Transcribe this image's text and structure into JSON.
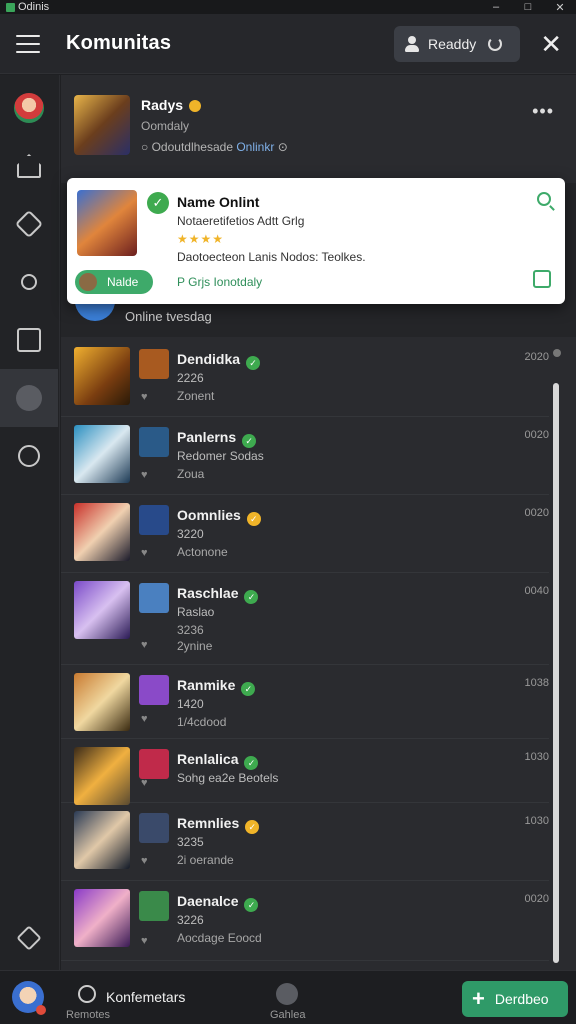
{
  "window": {
    "title": "Odinis",
    "controls": [
      "–",
      "□",
      "✕"
    ]
  },
  "header": {
    "title": "Komunitas",
    "ready_label": "Readdy",
    "close_label": "✕"
  },
  "sidebar": {
    "items": [
      {
        "icon": "avatar-icon"
      },
      {
        "icon": "home-icon"
      },
      {
        "icon": "tag-icon"
      },
      {
        "icon": "key-icon"
      },
      {
        "icon": "bag-icon"
      },
      {
        "icon": "chat-icon",
        "active": true
      },
      {
        "icon": "shield-icon"
      },
      {
        "icon": "diamond-icon"
      }
    ]
  },
  "featured": {
    "name": "Radys",
    "subtitle": "Oomdaly",
    "status_prefix": "Odoutdlhesade",
    "status_highlight": "Onlinkr",
    "more": "•••"
  },
  "popup": {
    "title": "Name Onlint",
    "description": "Notaeretifetios Adtt Grlg",
    "stars": "★★★★",
    "note": "Daotoecteon Lanis Nodos: Teolkes.",
    "button_label": "Nalde",
    "link": "P Grjs Ionotdaly"
  },
  "online_label": "Online  tvesdag",
  "list": {
    "rows": [
      {
        "name": "Dendidka",
        "badge": "green",
        "line1": "2226",
        "line2": "Zonent",
        "line3": "",
        "time": "2020"
      },
      {
        "name": "Panlerns",
        "badge": "green",
        "line1": "Redomer Sodas",
        "line2": "Zoua",
        "line3": "",
        "time": "0020"
      },
      {
        "name": "Oomnlies",
        "badge": "gold",
        "line1": "3220",
        "line2": "Actonone",
        "line3": "",
        "time": "0020"
      },
      {
        "name": "Raschlae",
        "badge": "green",
        "line1": "Raslao",
        "line2": "3236",
        "line3": "2ynine",
        "time": "0040"
      },
      {
        "name": "Ranmike",
        "badge": "green",
        "line1": "1420",
        "line2": "1/4cdood",
        "line3": "",
        "time": "1038"
      },
      {
        "name": "Renlalica",
        "badge": "green",
        "line1": "Sohg ea2e Beotels",
        "line2": "",
        "line3": "",
        "time": "1030"
      },
      {
        "name": "Remnlies",
        "badge": "gold",
        "line1": "3235",
        "line2": "2i oerande",
        "line3": "",
        "time": "1030"
      },
      {
        "name": "Daenalce",
        "badge": "green",
        "line1": "3226",
        "line2": "Aocdage Eoocd",
        "line3": "",
        "time": "0020"
      }
    ]
  },
  "bottombar": {
    "title": "Konfemetars",
    "sub_label": "Remotes",
    "mid_label": "Gahlea",
    "cta_label": "Derdbeo",
    "cta_icon": "+"
  },
  "colors": {
    "accent_green": "#3eaa4f",
    "gold": "#f0b429",
    "bg": "#1f2023"
  }
}
